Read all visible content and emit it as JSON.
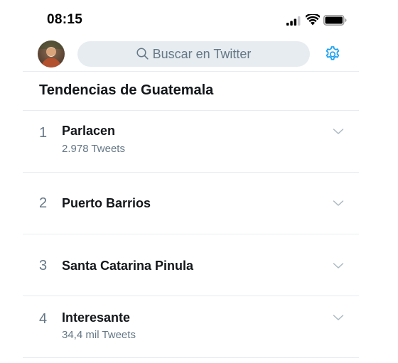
{
  "status_bar": {
    "time": "08:15",
    "icons": [
      "signal-icon",
      "wifi-icon",
      "battery-icon"
    ]
  },
  "header": {
    "search_placeholder": "Buscar en Twitter",
    "icons": [
      "avatar",
      "search-icon",
      "gear-icon"
    ]
  },
  "section": {
    "title": "Tendencias de Guatemala"
  },
  "trends": [
    {
      "rank": "1",
      "name": "Parlacen",
      "count": "2.978 Tweets"
    },
    {
      "rank": "2",
      "name": "Puerto Barrios",
      "count": ""
    },
    {
      "rank": "3",
      "name": "Santa Catarina Pinula",
      "count": ""
    },
    {
      "rank": "4",
      "name": "Interesante",
      "count": "34,4 mil Tweets"
    }
  ],
  "colors": {
    "accent": "#1da1f2",
    "secondary_text": "#657786",
    "divider": "#e6ecf0",
    "search_bg": "#e6ecf0"
  }
}
